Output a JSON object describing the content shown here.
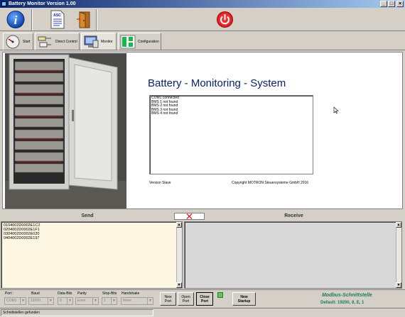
{
  "window": {
    "title": "Battery Monitor Version 1.00",
    "minimize": "_",
    "maximize": "□",
    "close": "×"
  },
  "tabs": [
    {
      "label": "Start",
      "icon": "gauge-icon"
    },
    {
      "label": "Direct Control",
      "icon": "connector-icon"
    },
    {
      "label": "Monitor",
      "icon": "monitor-icon"
    },
    {
      "label": "Configuration",
      "icon": "config-icon"
    }
  ],
  "main": {
    "heading": "Battery - Monitoring - System",
    "log": [
      "COM1 connected",
      "BMS 1 not found",
      "BMS 2 not found",
      "BMS 3 not found",
      "BMS 4 not found"
    ],
    "version": "Version Slave",
    "copyright": "Copyright MOTRON Steuersysteme GmbH 2016"
  },
  "send": {
    "header": "Send",
    "lines": [
      "0104002D0002E1C2",
      "0204002D0002E1F1",
      "0304002D0002E020",
      "0404002D0002E197"
    ]
  },
  "receive": {
    "header": "Receive"
  },
  "port_settings": {
    "port": {
      "label": "Port :",
      "value": "COM1"
    },
    "baud": {
      "label": "Baud",
      "value": "19200"
    },
    "databits": {
      "label": "Data-Bits",
      "value": "8"
    },
    "parity": {
      "label": "Parity",
      "value": "Even"
    },
    "stopbits": {
      "label": "Stop-Bits",
      "value": "1"
    },
    "handshake": {
      "label": "Handshake",
      "value": "None"
    }
  },
  "buttons": {
    "new_port": [
      "New",
      "Port"
    ],
    "open_port": [
      "Open",
      "Port"
    ],
    "close_port": [
      "Close",
      "Port"
    ],
    "new_startup": [
      "New",
      "Startup"
    ]
  },
  "modbus": {
    "title": "Modbus-Schnittstelle",
    "default": "Default: 19200, 8, E, 1"
  },
  "status": "Schnittstellen gefunden",
  "colors": {
    "accent_title": "#0b2266",
    "modbus_green": "#1f7a5a",
    "power_red": "#e02020",
    "led_green": "#5ec85e"
  }
}
